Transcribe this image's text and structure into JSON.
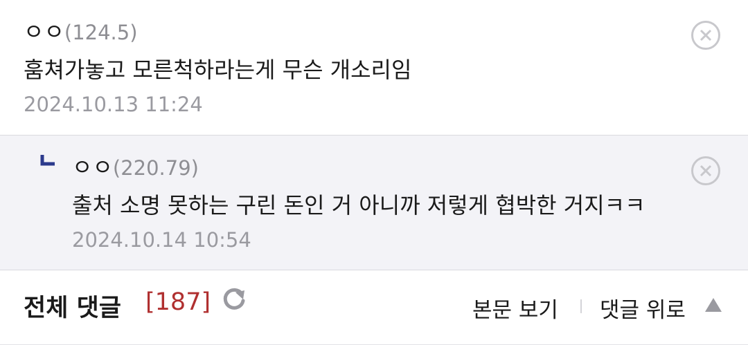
{
  "comments": [
    {
      "nick": "ㅇㅇ",
      "ip": "(124.5)",
      "body": "훔쳐가놓고 모른척하라는게 무슨 개소리임",
      "date": "2024.10.13 11:24"
    }
  ],
  "reply": {
    "nick": "ㅇㅇ",
    "ip": "(220.79)",
    "body": "출처 소명 못하는 구린 돈인 거 아니까 저렇게 협박한 거지ㅋㅋ",
    "date": "2024.10.14 10:54"
  },
  "footer": {
    "title": "전체 댓글",
    "count": "[187]",
    "view_body": "본문 보기",
    "to_comments_top": "댓글 위로"
  },
  "colors": {
    "count": "#b03030",
    "reply_bg": "#f3f3f7",
    "muted": "#9a9aa0",
    "reply_arrow": "#2b3a8c"
  },
  "icons": {
    "delete": "close-circle-icon",
    "reply": "reply-arrow-icon",
    "refresh": "refresh-icon",
    "up": "triangle-up-icon"
  }
}
